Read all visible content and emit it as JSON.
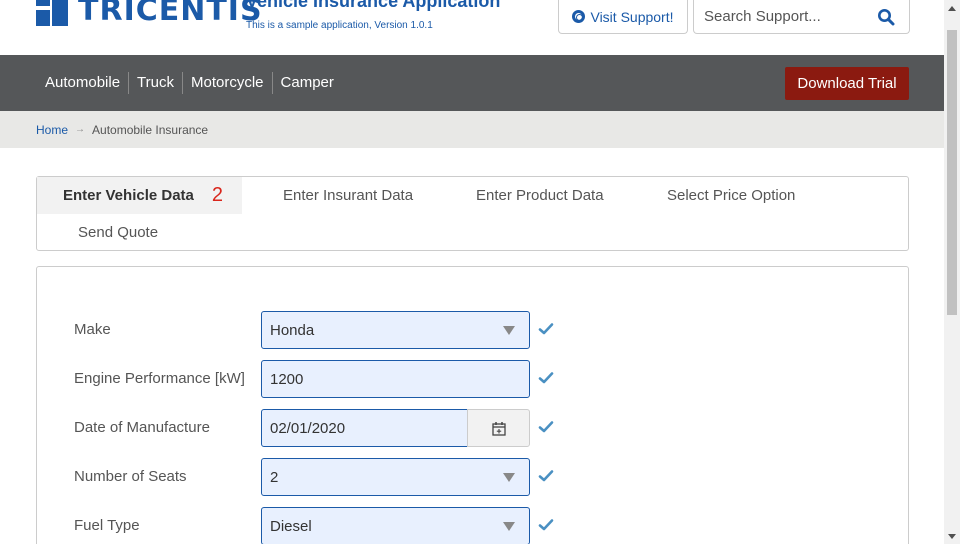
{
  "header": {
    "logo_text": "TRICENTIS",
    "app_title": "Vehicle Insurance Application",
    "app_subtitle": "This is a sample application, Version 1.0.1",
    "support_label": "Visit Support!",
    "search_placeholder": "Search Support...",
    "support_icon": "lifebuoy-icon",
    "search_icon": "search-icon"
  },
  "nav": {
    "items": [
      {
        "label": "Automobile"
      },
      {
        "label": "Truck"
      },
      {
        "label": "Motorcycle"
      },
      {
        "label": "Camper"
      }
    ],
    "download_label": "Download Trial"
  },
  "breadcrumb": {
    "home": "Home",
    "separator": "→",
    "current": "Automobile Insurance"
  },
  "tabs": {
    "items": [
      {
        "label": "Enter Vehicle Data",
        "badge": "2",
        "active": true
      },
      {
        "label": "Enter Insurant Data"
      },
      {
        "label": "Enter Product Data"
      },
      {
        "label": "Select Price Option"
      },
      {
        "label": "Send Quote"
      }
    ]
  },
  "form": {
    "fields": [
      {
        "label": "Make",
        "value": "Honda",
        "type": "select"
      },
      {
        "label": "Engine Performance [kW]",
        "value": "1200",
        "type": "text"
      },
      {
        "label": "Date of Manufacture",
        "value": "02/01/2020",
        "type": "date"
      },
      {
        "label": "Number of Seats",
        "value": "2",
        "type": "select"
      },
      {
        "label": "Fuel Type",
        "value": "Diesel",
        "type": "select"
      }
    ]
  },
  "colors": {
    "brand_blue": "#1b5aa8",
    "nav_bg": "#555759",
    "download_red": "#8b1a10",
    "badge_red": "#d9261c",
    "check_blue": "#4a90c2",
    "field_bg": "#e8f0fe"
  }
}
